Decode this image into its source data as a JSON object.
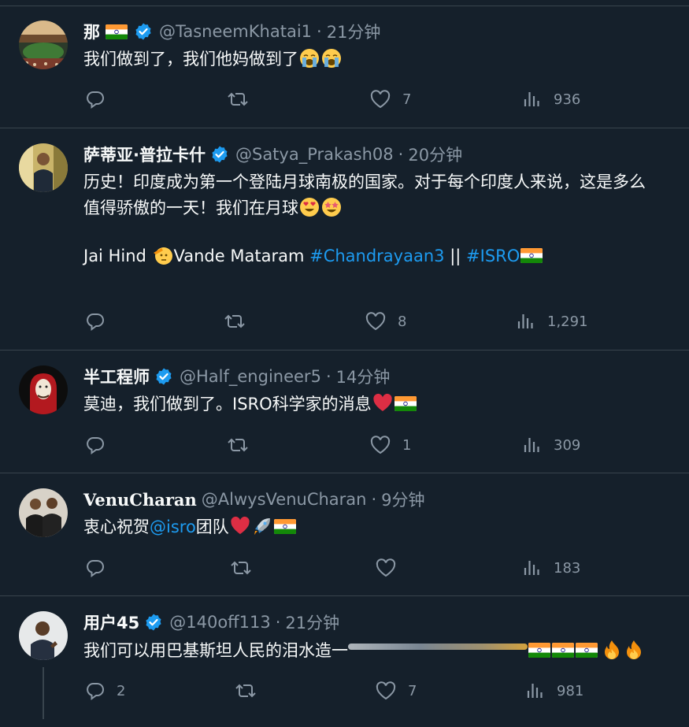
{
  "tweets": [
    {
      "name": "那",
      "handle": "@TasneemKhatai1",
      "time": "21分钟",
      "text": "我们做到了，我们他妈做到了",
      "replies": "",
      "retweets": "",
      "likes": "7",
      "views": "936"
    },
    {
      "name": "萨蒂亚·普拉卡什",
      "handle": "@Satya_Prakash08",
      "time": "20分钟",
      "line1": "历史！印度成为第一个登陆月球南极的国家。对于每个印度人来说，这是多么",
      "line2": "值得骄傲的一天！我们在月球",
      "line3_a": "Jai Hind ",
      "line3_b": "Vande Mataram ",
      "hashtag1": "#Chandrayaan3",
      "sep": " || ",
      "hashtag2": "#ISRO",
      "replies": "",
      "retweets": "",
      "likes": "8",
      "views": "1,291"
    },
    {
      "name": "半工程师",
      "handle": "@Half_engineer5",
      "time": "14分钟",
      "text": "莫迪，我们做到了。ISRO科学家的消息",
      "replies": "",
      "retweets": "",
      "likes": "1",
      "views": "309"
    },
    {
      "name": "VenuCharan",
      "handle": "@AlwysVenuCharan",
      "time": "9分钟",
      "text_a": "衷心祝贺",
      "mention": "@isro",
      "text_b": "团队",
      "replies": "",
      "retweets": "",
      "likes": "",
      "views": "183"
    },
    {
      "name": "用户45",
      "handle": "@140off113",
      "time": "21分钟",
      "text": "我们可以用巴基斯坦人民的泪水造一",
      "replies": "2",
      "retweets": "",
      "likes": "7",
      "views": "981"
    }
  ],
  "colors": {
    "background": "#15202b",
    "text": "#f7f9f9",
    "muted": "#8b98a5",
    "link": "#1d9bf0",
    "verified": "#1d9bf0",
    "divider": "#38444d"
  },
  "icons": [
    "reply-icon",
    "retweet-icon",
    "like-icon",
    "views-icon",
    "verified-badge-icon",
    "india-flag-icon",
    "crying-face-emoji",
    "heart-eyes-emoji",
    "star-struck-emoji",
    "saluting-face-emoji",
    "red-heart-emoji",
    "rocket-emoji",
    "fire-emoji"
  ]
}
